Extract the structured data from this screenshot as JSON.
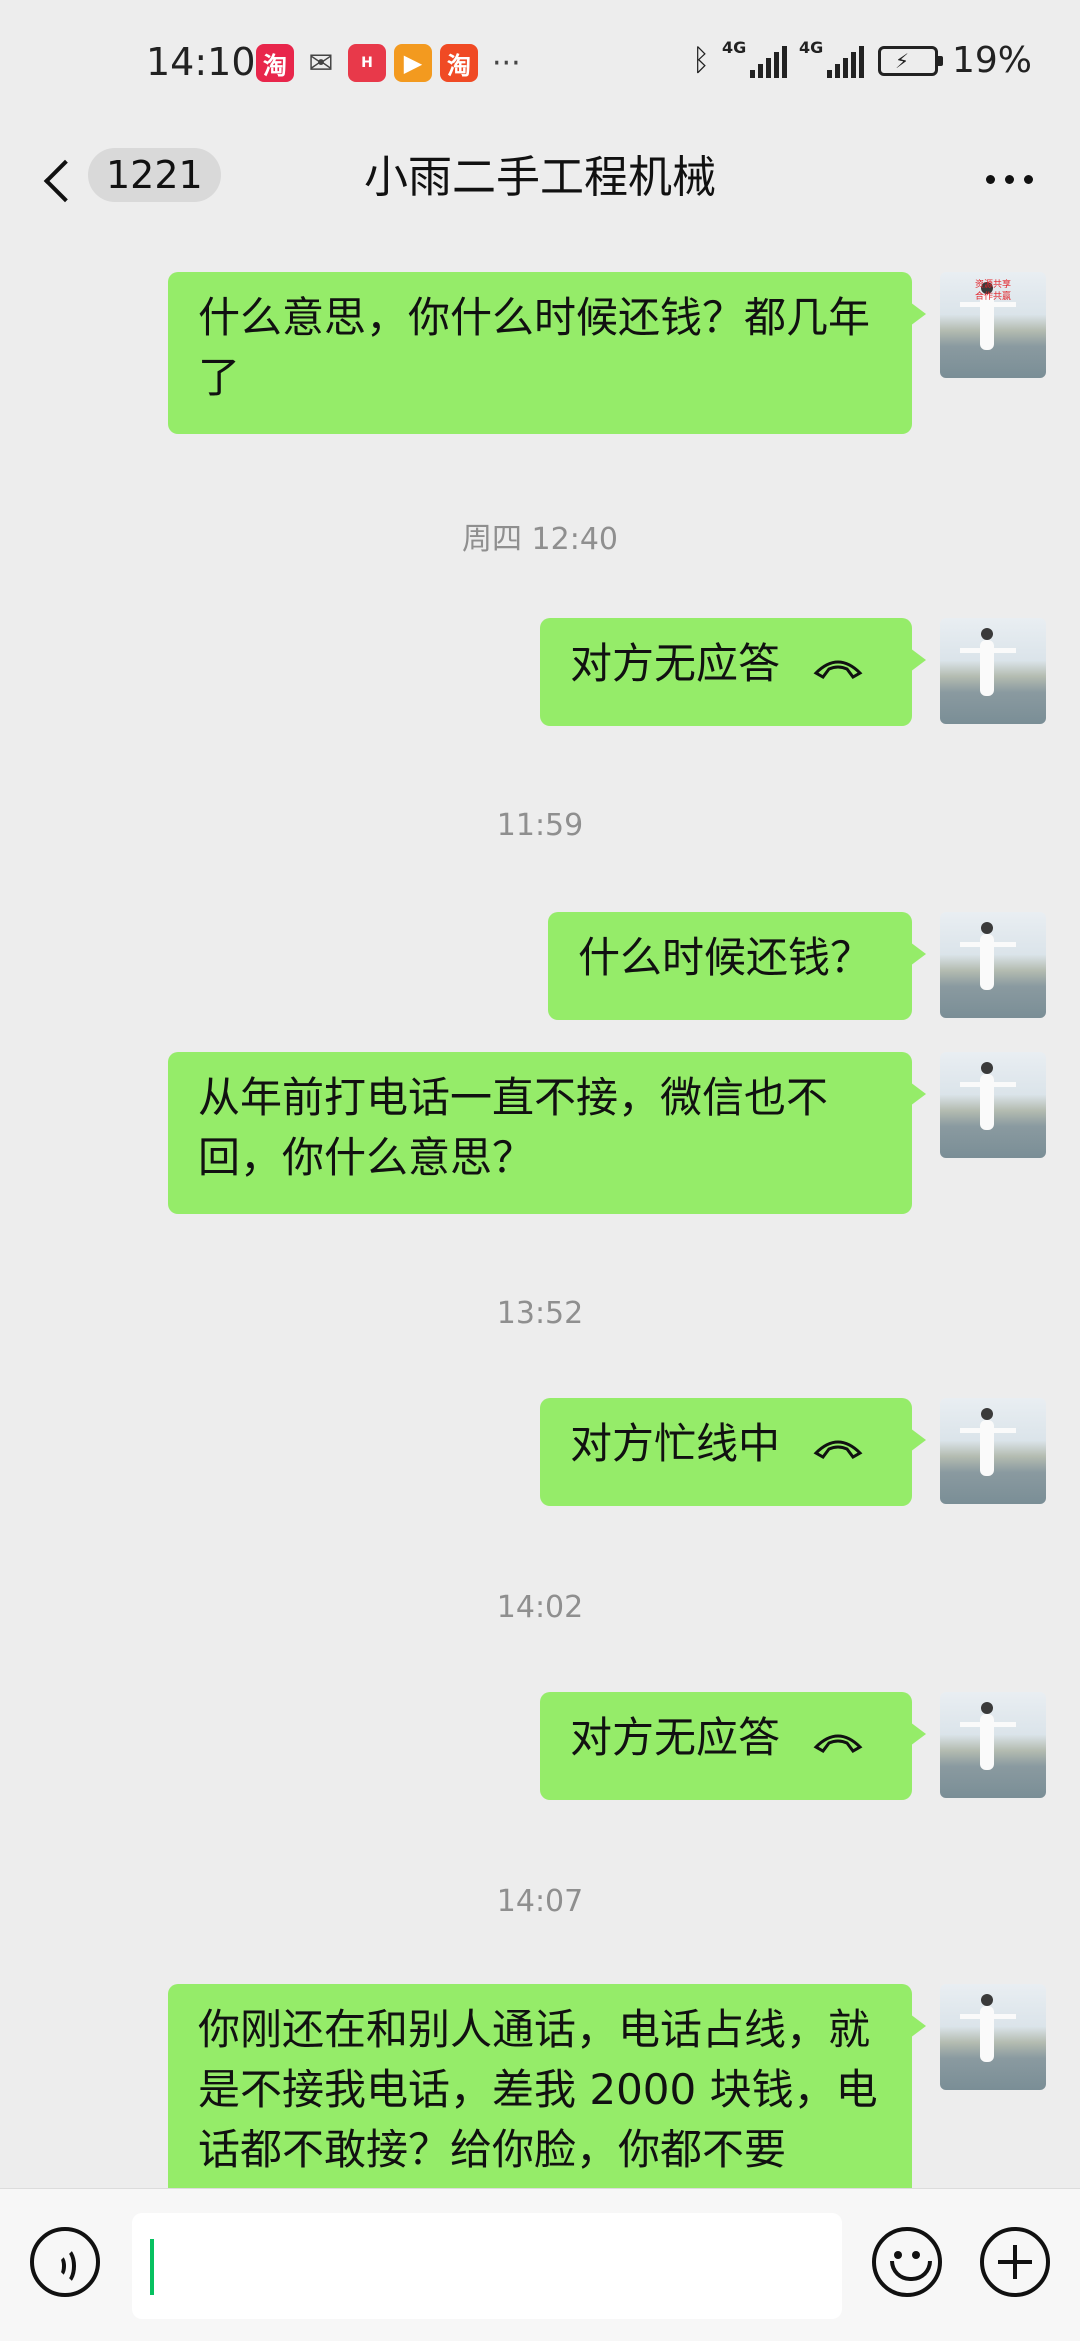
{
  "status_bar": {
    "time": "14:10",
    "app_icons": [
      "taobao-icon",
      "wechat-icon",
      "huawei-store-icon",
      "video-icon",
      "taobao-icon"
    ],
    "more": "···",
    "network_1": "4G",
    "network_2": "4G",
    "battery": "19%"
  },
  "header": {
    "unread_count": "1221",
    "title": "小雨二手工程机械"
  },
  "messages": [
    {
      "type": "text",
      "text": "什么意思，你什么时候还钱？都几年了"
    },
    {
      "type": "time",
      "text": "周四 12:40"
    },
    {
      "type": "call",
      "text": "对方无应答"
    },
    {
      "type": "time",
      "text": "11:59"
    },
    {
      "type": "text",
      "text": "什么时候还钱？"
    },
    {
      "type": "text",
      "text": "从年前打电话一直不接，微信也不回，你什么意思？"
    },
    {
      "type": "time",
      "text": "13:52"
    },
    {
      "type": "call",
      "text": "对方忙线中"
    },
    {
      "type": "time",
      "text": "14:02"
    },
    {
      "type": "call",
      "text": "对方无应答"
    },
    {
      "type": "time",
      "text": "14:07"
    },
    {
      "type": "text",
      "text": "你刚还在和别人通话，电话占线，就是不接我电话，差我 2000 块钱，电话都不敢接？给你脸，你都不要"
    }
  ],
  "avatar_caption": [
    "资源共享",
    "合作共赢"
  ],
  "input_bar": {
    "text_value": ""
  }
}
